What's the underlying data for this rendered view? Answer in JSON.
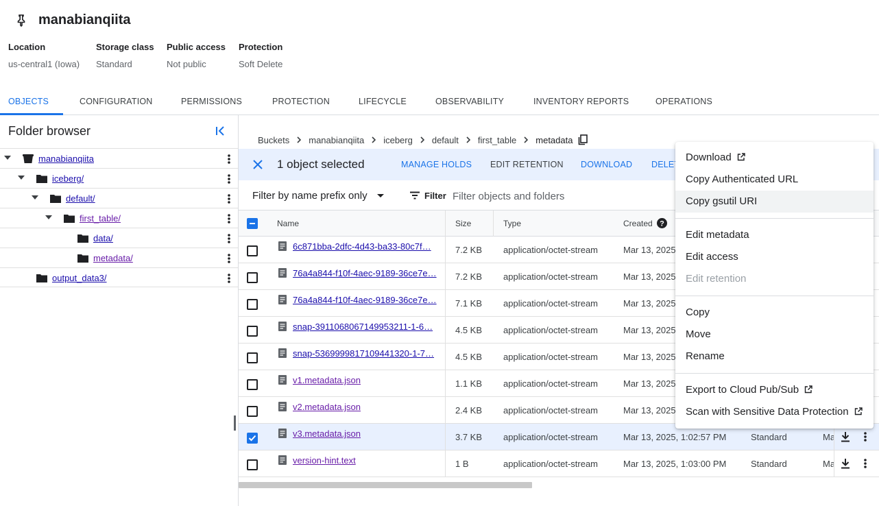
{
  "bucket": {
    "name": "manabianqiita",
    "pin_icon": "pin-icon",
    "details": [
      {
        "label": "Location",
        "value": "us-central1 (Iowa)"
      },
      {
        "label": "Storage class",
        "value": "Standard"
      },
      {
        "label": "Public access",
        "value": "Not public"
      },
      {
        "label": "Protection",
        "value": "Soft Delete"
      }
    ]
  },
  "tabs": [
    "OBJECTS",
    "CONFIGURATION",
    "PERMISSIONS",
    "PROTECTION",
    "LIFECYCLE",
    "OBSERVABILITY",
    "INVENTORY REPORTS",
    "OPERATIONS"
  ],
  "active_tab": "OBJECTS",
  "folder_browser": {
    "title": "Folder browser",
    "tree": [
      {
        "label": "manabianqiita",
        "level": 0,
        "kind": "bucket",
        "expanded": true
      },
      {
        "label": "iceberg/",
        "level": 1,
        "kind": "folder",
        "expanded": true
      },
      {
        "label": "default/",
        "level": 2,
        "kind": "folder",
        "expanded": true
      },
      {
        "label": "first_table/",
        "level": 3,
        "kind": "folder",
        "expanded": true
      },
      {
        "label": "data/",
        "level": 4,
        "kind": "folder",
        "expanded": false
      },
      {
        "label": "metadata/",
        "level": 4,
        "kind": "folder",
        "expanded": false
      },
      {
        "label": "output_data3/",
        "level": 2,
        "kind": "folder",
        "expanded": false
      }
    ]
  },
  "breadcrumb": {
    "items": [
      "Buckets",
      "manabianqiita",
      "iceberg",
      "default",
      "first_table"
    ],
    "current": "metadata"
  },
  "selection_bar": {
    "count_text": "1 object selected",
    "actions": [
      "MANAGE HOLDS",
      "EDIT RETENTION",
      "DOWNLOAD",
      "DELETE"
    ]
  },
  "filter": {
    "prefix_label": "Filter by name prefix only",
    "filter_label": "Filter",
    "placeholder": "Filter objects and folders"
  },
  "table": {
    "columns": {
      "name": "Name",
      "size": "Size",
      "type": "Type",
      "created": "Created"
    },
    "rows": [
      {
        "name": "6c871bba-2dfc-4d43-ba33-80c7f…",
        "size": "7.2 KB",
        "type": "application/octet-stream",
        "created": "Mar 13, 2025",
        "storage_class": "",
        "rest": "",
        "checked": false
      },
      {
        "name": "76a4a844-f10f-4aec-9189-36ce7e…",
        "size": "7.2 KB",
        "type": "application/octet-stream",
        "created": "Mar 13, 2025",
        "storage_class": "",
        "rest": "",
        "checked": false
      },
      {
        "name": "76a4a844-f10f-4aec-9189-36ce7e…",
        "size": "7.1 KB",
        "type": "application/octet-stream",
        "created": "Mar 13, 2025",
        "storage_class": "",
        "rest": "",
        "checked": false
      },
      {
        "name": "snap-3911068067149953211-1-6…",
        "size": "4.5 KB",
        "type": "application/octet-stream",
        "created": "Mar 13, 2025",
        "storage_class": "",
        "rest": "",
        "checked": false
      },
      {
        "name": "snap-5369999817109441320-1-7…",
        "size": "4.5 KB",
        "type": "application/octet-stream",
        "created": "Mar 13, 2025",
        "storage_class": "",
        "rest": "",
        "checked": false
      },
      {
        "name": "v1.metadata.json",
        "size": "1.1 KB",
        "type": "application/octet-stream",
        "created": "Mar 13, 2025",
        "storage_class": "",
        "rest": "",
        "checked": false
      },
      {
        "name": "v2.metadata.json",
        "size": "2.4 KB",
        "type": "application/octet-stream",
        "created": "Mar 13, 2025",
        "storage_class": "",
        "rest": "",
        "checked": false
      },
      {
        "name": "v3.metadata.json",
        "size": "3.7 KB",
        "type": "application/octet-stream",
        "created": "Mar 13, 2025, 1:02:57 PM",
        "storage_class": "Standard",
        "rest": "Ma",
        "checked": true
      },
      {
        "name": "version-hint.text",
        "size": "1 B",
        "type": "application/octet-stream",
        "created": "Mar 13, 2025, 1:03:00 PM",
        "storage_class": "Standard",
        "rest": "Ma",
        "checked": false
      }
    ]
  },
  "context_menu": {
    "groups": [
      [
        {
          "label": "Download",
          "external": true,
          "disabled": false,
          "hover": false
        },
        {
          "label": "Copy Authenticated URL",
          "external": false,
          "disabled": false,
          "hover": false
        },
        {
          "label": "Copy gsutil URI",
          "external": false,
          "disabled": false,
          "hover": true
        }
      ],
      [
        {
          "label": "Edit metadata",
          "external": false,
          "disabled": false,
          "hover": false
        },
        {
          "label": "Edit access",
          "external": false,
          "disabled": false,
          "hover": false
        },
        {
          "label": "Edit retention",
          "external": false,
          "disabled": true,
          "hover": false
        }
      ],
      [
        {
          "label": "Copy",
          "external": false,
          "disabled": false,
          "hover": false
        },
        {
          "label": "Move",
          "external": false,
          "disabled": false,
          "hover": false
        },
        {
          "label": "Rename",
          "external": false,
          "disabled": false,
          "hover": false
        }
      ],
      [
        {
          "label": "Export to Cloud Pub/Sub",
          "external": true,
          "disabled": false,
          "hover": false
        },
        {
          "label": "Scan with Sensitive Data Protection",
          "external": true,
          "disabled": false,
          "hover": false
        }
      ]
    ]
  },
  "colors": {
    "accent": "#1a73e8",
    "selected_row": "#e8f0fe",
    "link": "#1a0dab",
    "visited_link": "#681da8"
  }
}
